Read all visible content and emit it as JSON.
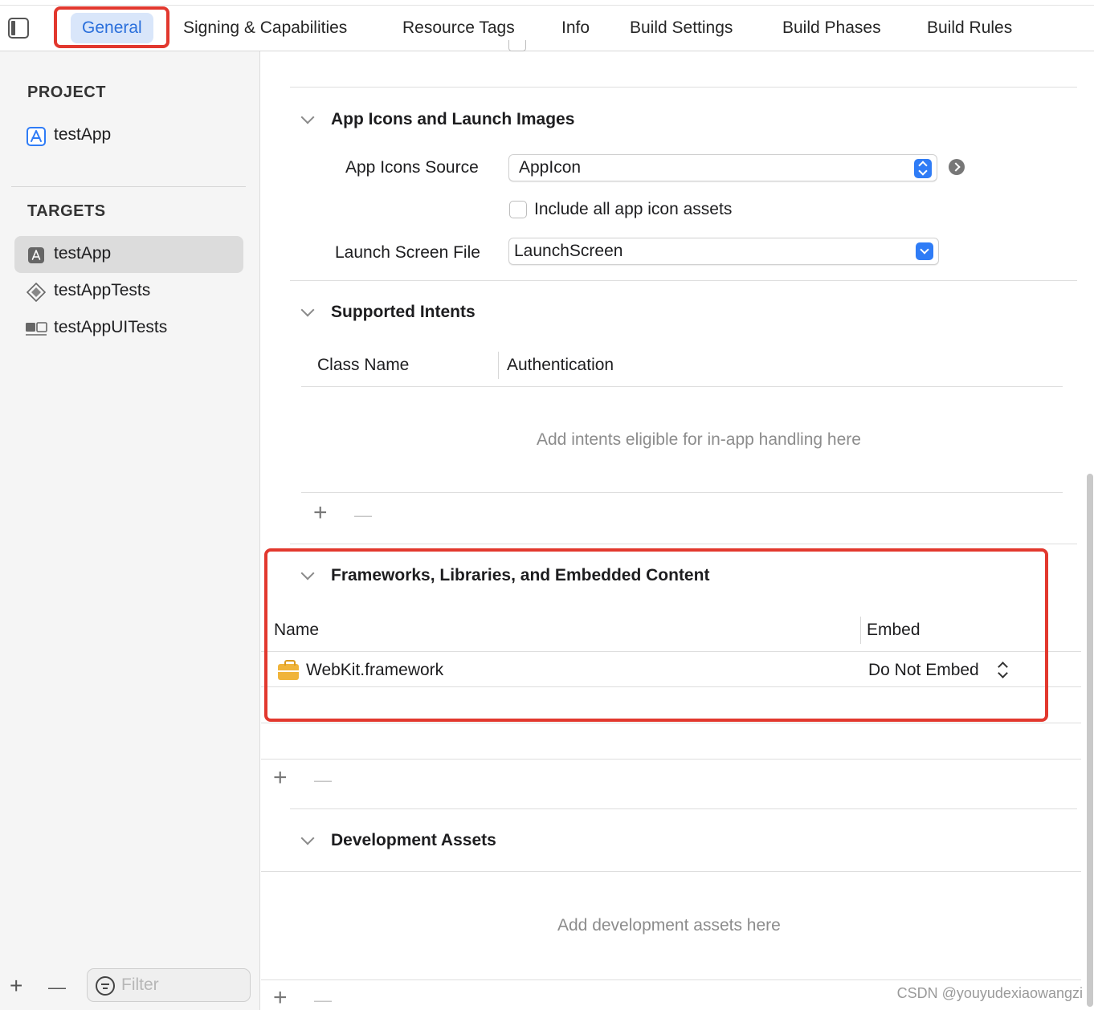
{
  "tabs": {
    "general": "General",
    "signing": "Signing & Capabilities",
    "resource_tags": "Resource Tags",
    "info": "Info",
    "build_settings": "Build Settings",
    "build_phases": "Build Phases",
    "build_rules": "Build Rules"
  },
  "sidebar": {
    "project_heading": "PROJECT",
    "project_item": "testApp",
    "targets_heading": "TARGETS",
    "targets": [
      "testApp",
      "testAppTests",
      "testAppUITests"
    ],
    "filter_placeholder": "Filter"
  },
  "app_icons": {
    "title": "App Icons and Launch Images",
    "source_label": "App Icons Source",
    "source_value": "AppIcon",
    "include_all_label": "Include all app icon assets",
    "launch_label": "Launch Screen File",
    "launch_value": "LaunchScreen"
  },
  "intents": {
    "title": "Supported Intents",
    "col_class": "Class Name",
    "col_auth": "Authentication",
    "empty": "Add intents eligible for in-app handling here"
  },
  "frameworks": {
    "title": "Frameworks, Libraries, and Embedded Content",
    "col_name": "Name",
    "col_embed": "Embed",
    "rows": [
      {
        "name": "WebKit.framework",
        "embed": "Do Not Embed"
      }
    ]
  },
  "dev_assets": {
    "title": "Development Assets",
    "empty": "Add development assets here"
  },
  "controls": {
    "plus": "+",
    "minus": "—"
  },
  "watermark": "CSDN @youyudexiaowangzi",
  "colors": {
    "accent": "#2f7cf6",
    "highlight_box": "#e2382e",
    "active_tab_bg": "#d9e6fa"
  }
}
